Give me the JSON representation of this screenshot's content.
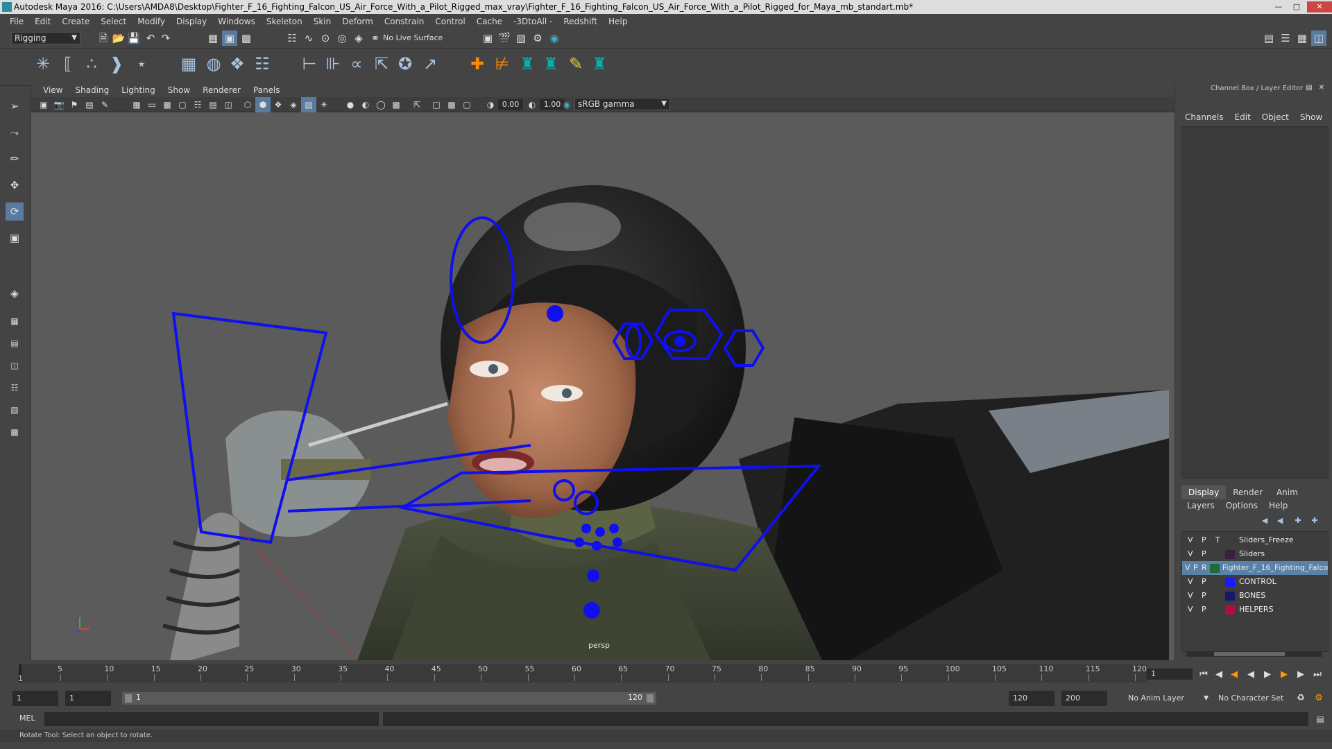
{
  "title_bar": {
    "text": "Autodesk Maya 2016: C:\\Users\\AMDA8\\Desktop\\Fighter_F_16_Fighting_Falcon_US_Air_Force_With_a_Pilot_Rigged_max_vray\\Fighter_F_16_Fighting_Falcon_US_Air_Force_With_a_Pilot_Rigged_for_Maya_mb_standart.mb*"
  },
  "menu": [
    "File",
    "Edit",
    "Create",
    "Select",
    "Modify",
    "Display",
    "Windows",
    "Skeleton",
    "Skin",
    "Deform",
    "Constrain",
    "Control",
    "Cache",
    "-3DtoAll -",
    "Redshift",
    "Help"
  ],
  "mode_selector": "Rigging",
  "live_surface": "No Live Surface",
  "viewport_menu": [
    "View",
    "Shading",
    "Lighting",
    "Show",
    "Renderer",
    "Panels"
  ],
  "viewport_bar": {
    "exposure": "0.00",
    "gamma": "1.00",
    "color_space": "sRGB gamma"
  },
  "viewport_label": "persp",
  "channel_box": {
    "title": "Channel Box / Layer Editor",
    "tabs": [
      "Channels",
      "Edit",
      "Object",
      "Show"
    ]
  },
  "layer_editor": {
    "tabs": [
      "Display",
      "Render",
      "Anim"
    ],
    "menu": [
      "Layers",
      "Options",
      "Help"
    ],
    "layers": [
      {
        "v": "V",
        "p": "P",
        "t": "T",
        "name": "Sliders_Freeze",
        "color": "#3c3c3c"
      },
      {
        "v": "V",
        "p": "P",
        "t": "",
        "name": "Sliders",
        "color": "#3a2040"
      },
      {
        "v": "V",
        "p": "P",
        "t": "R",
        "name": "Fighter_F_16_Fighting_Falco",
        "color": "#1e6a3a",
        "selected": true
      },
      {
        "v": "V",
        "p": "P",
        "t": "",
        "name": "CONTROL",
        "color": "#1a1aff"
      },
      {
        "v": "V",
        "p": "P",
        "t": "",
        "name": "BONES",
        "color": "#16166a"
      },
      {
        "v": "V",
        "p": "P",
        "t": "",
        "name": "HELPERS",
        "color": "#b0103a"
      }
    ]
  },
  "timeline": {
    "ticks": [
      "5",
      "10",
      "15",
      "20",
      "25",
      "30",
      "35",
      "40",
      "45",
      "50",
      "55",
      "60",
      "65",
      "70",
      "75",
      "80",
      "85",
      "90",
      "95",
      "100",
      "105",
      "110",
      "115",
      "120"
    ],
    "start_label": "1",
    "current_frame": "1"
  },
  "range": {
    "start": "1",
    "playback_start": "1",
    "slider_start": "1",
    "slider_end": "120",
    "playback_end": "120",
    "end": "200",
    "anim_layer": "No Anim Layer",
    "character_set": "No Character Set"
  },
  "command_line": {
    "label": "MEL"
  },
  "help_line": "Rotate Tool: Select an object to rotate."
}
